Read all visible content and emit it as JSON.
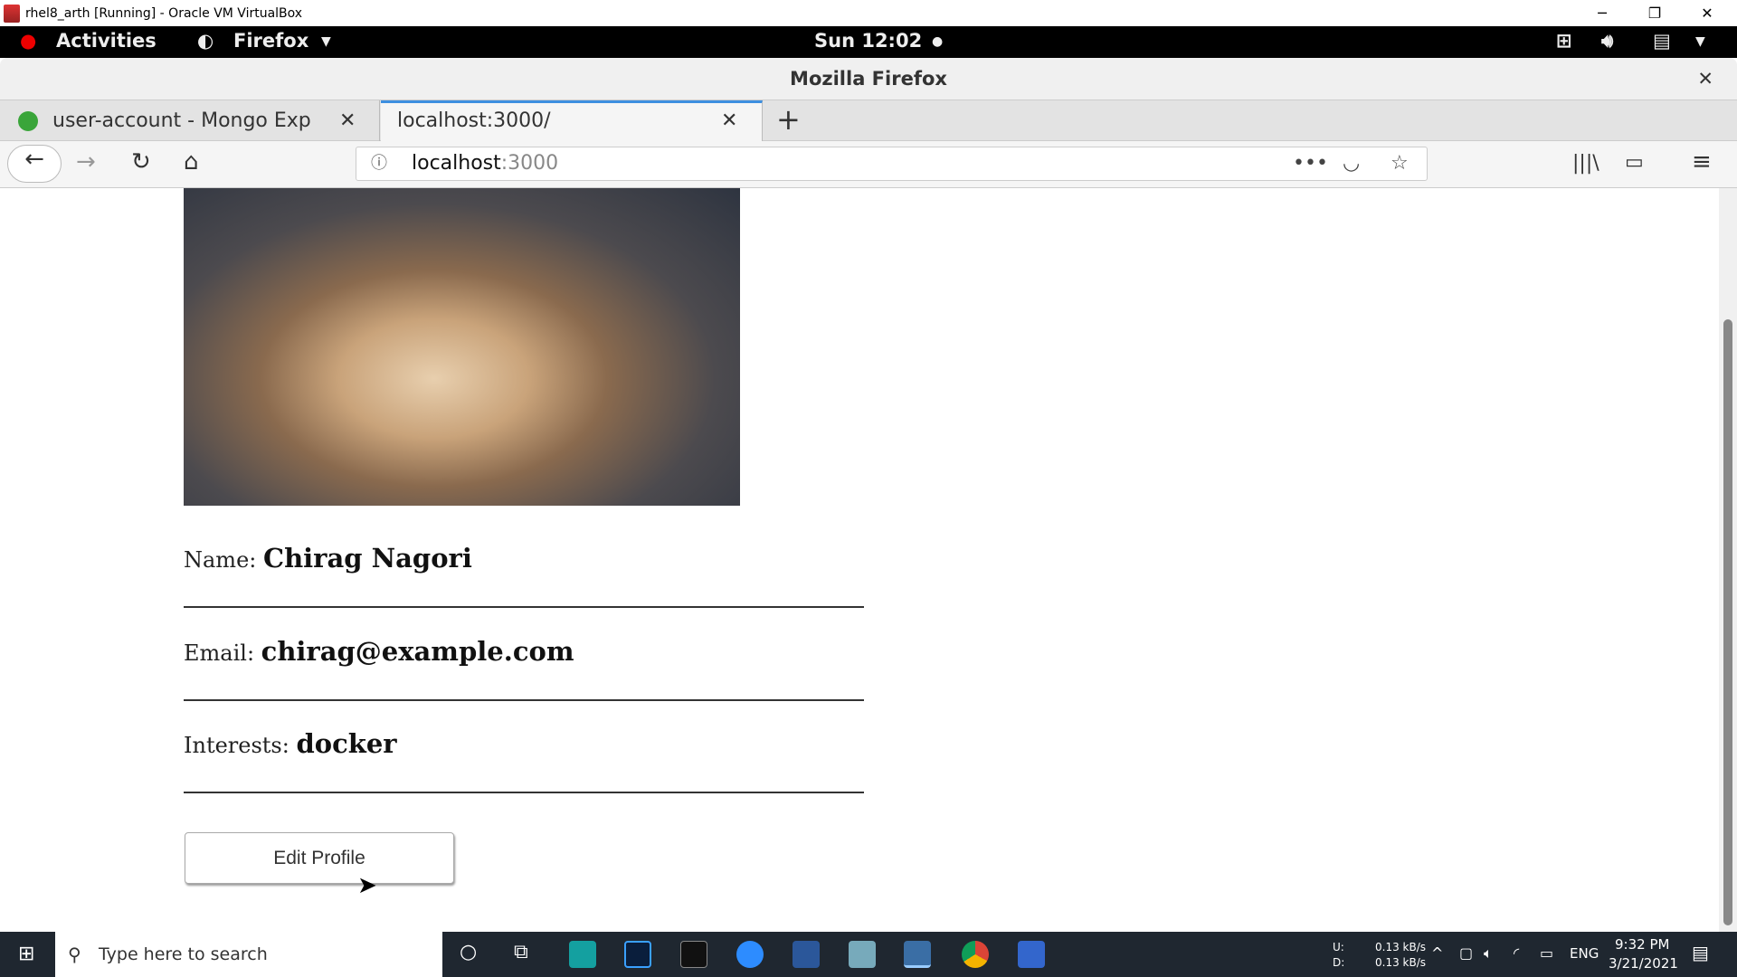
{
  "vbox": {
    "title": "rhel8_arth [Running] - Oracle VM VirtualBox"
  },
  "gnome": {
    "activities": "Activities",
    "app": "Firefox",
    "clock": "Sun 12:02"
  },
  "firefox": {
    "window_title": "Mozilla Firefox",
    "tabs": [
      {
        "label": "user-account - Mongo Exp"
      },
      {
        "label": "localhost:3000/"
      }
    ],
    "url_host": "localhost",
    "url_port": ":3000"
  },
  "profile": {
    "name_label": "Name:",
    "name": "Chirag Nagori",
    "email_label": "Email:",
    "email": "chirag@example.com",
    "interests_label": "Interests:",
    "interests": "docker",
    "edit_button": "Edit Profile"
  },
  "taskbar": {
    "search_placeholder": "Type here to search",
    "net_up_label": "U:",
    "net_down_label": "D:",
    "net_up": "0.13 kB/s",
    "net_down": "0.13 kB/s",
    "lang": "ENG",
    "time": "9:32 PM",
    "date": "3/21/2021"
  }
}
